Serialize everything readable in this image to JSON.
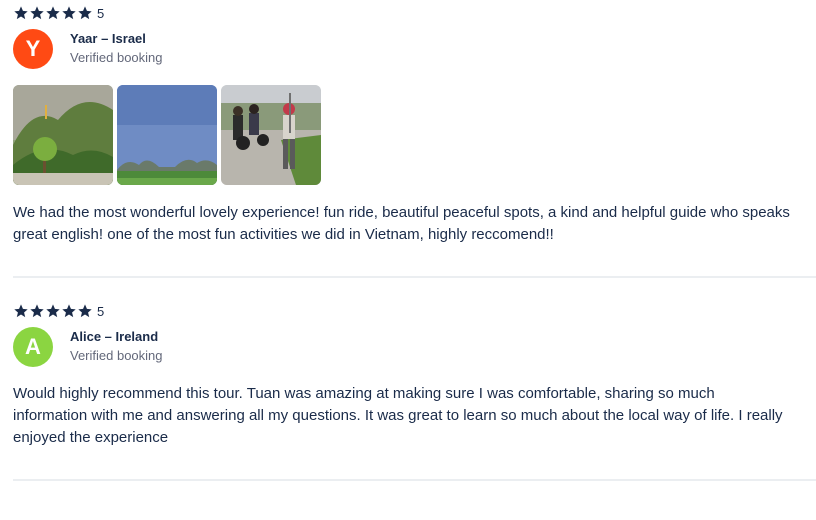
{
  "reviews": [
    {
      "rating": "5",
      "stars": 5,
      "avatar_letter": "Y",
      "avatar_color": "#ff4a14",
      "author": "Yaar – Israel",
      "verified": "Verified booking",
      "photo_icons": [
        "landscape-photo",
        "landscape-photo",
        "landscape-photo"
      ],
      "text": "We had the most wonderful lovely experience! fun ride, beautiful peaceful spots, a kind and helpful guide who speaks great english! one of the most fun activities we did in Vietnam, highly reccomend!!"
    },
    {
      "rating": "5",
      "stars": 5,
      "avatar_letter": "A",
      "avatar_color": "#8bd541",
      "author": "Alice – Ireland",
      "verified": "Verified booking",
      "text": "Would highly recommend this tour. Tuan was amazing at making sure I was comfortable, sharing so much information with me and answering all my questions. It was great to learn so much about the local way of life. I really enjoyed the experience"
    }
  ],
  "colors": {
    "text": "#1a2b49",
    "muted": "#63687a",
    "divider": "#ebeef1"
  }
}
